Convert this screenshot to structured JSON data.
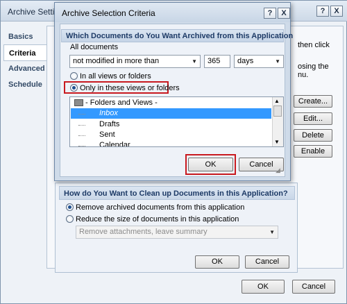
{
  "background_window": {
    "title": "Archive Settin",
    "tabs": [
      "Basics",
      "Criteria",
      "Advanced",
      "Schedule"
    ],
    "side_text": [
      "then click",
      "osing the",
      "nu."
    ],
    "buttons": {
      "create": "Create...",
      "edit": "Edit...",
      "delete": "Delete",
      "enable": "Enable"
    },
    "cleanup": {
      "header": "How do You Want to Clean up Documents in this Application?",
      "option_remove": "Remove archived documents from this application",
      "option_reduce": "Reduce the size of documents in this application",
      "reduce_select": "Remove attachments, leave summary",
      "ok": "OK",
      "cancel": "Cancel"
    },
    "footer_ok": "OK",
    "footer_cancel": "Cancel",
    "title_buttons": {
      "help": "?",
      "close": "X"
    }
  },
  "dialog": {
    "title": "Archive Selection Criteria",
    "title_buttons": {
      "help": "?",
      "close": "X"
    },
    "header": "Which Documents do You Want Archived from this Application",
    "all_documents_label": "All documents",
    "condition_select": "not modified in more than",
    "days_value": "365",
    "unit_select": "days",
    "radio_all_views": "In all views or folders",
    "radio_only_views": "Only in these views or folders",
    "tree": {
      "root": "- Folders and Views -",
      "items": [
        "Inbox",
        "Drafts",
        "Sent",
        "Calendar"
      ],
      "selected": "Inbox"
    },
    "ok": "OK",
    "cancel": "Cancel"
  }
}
